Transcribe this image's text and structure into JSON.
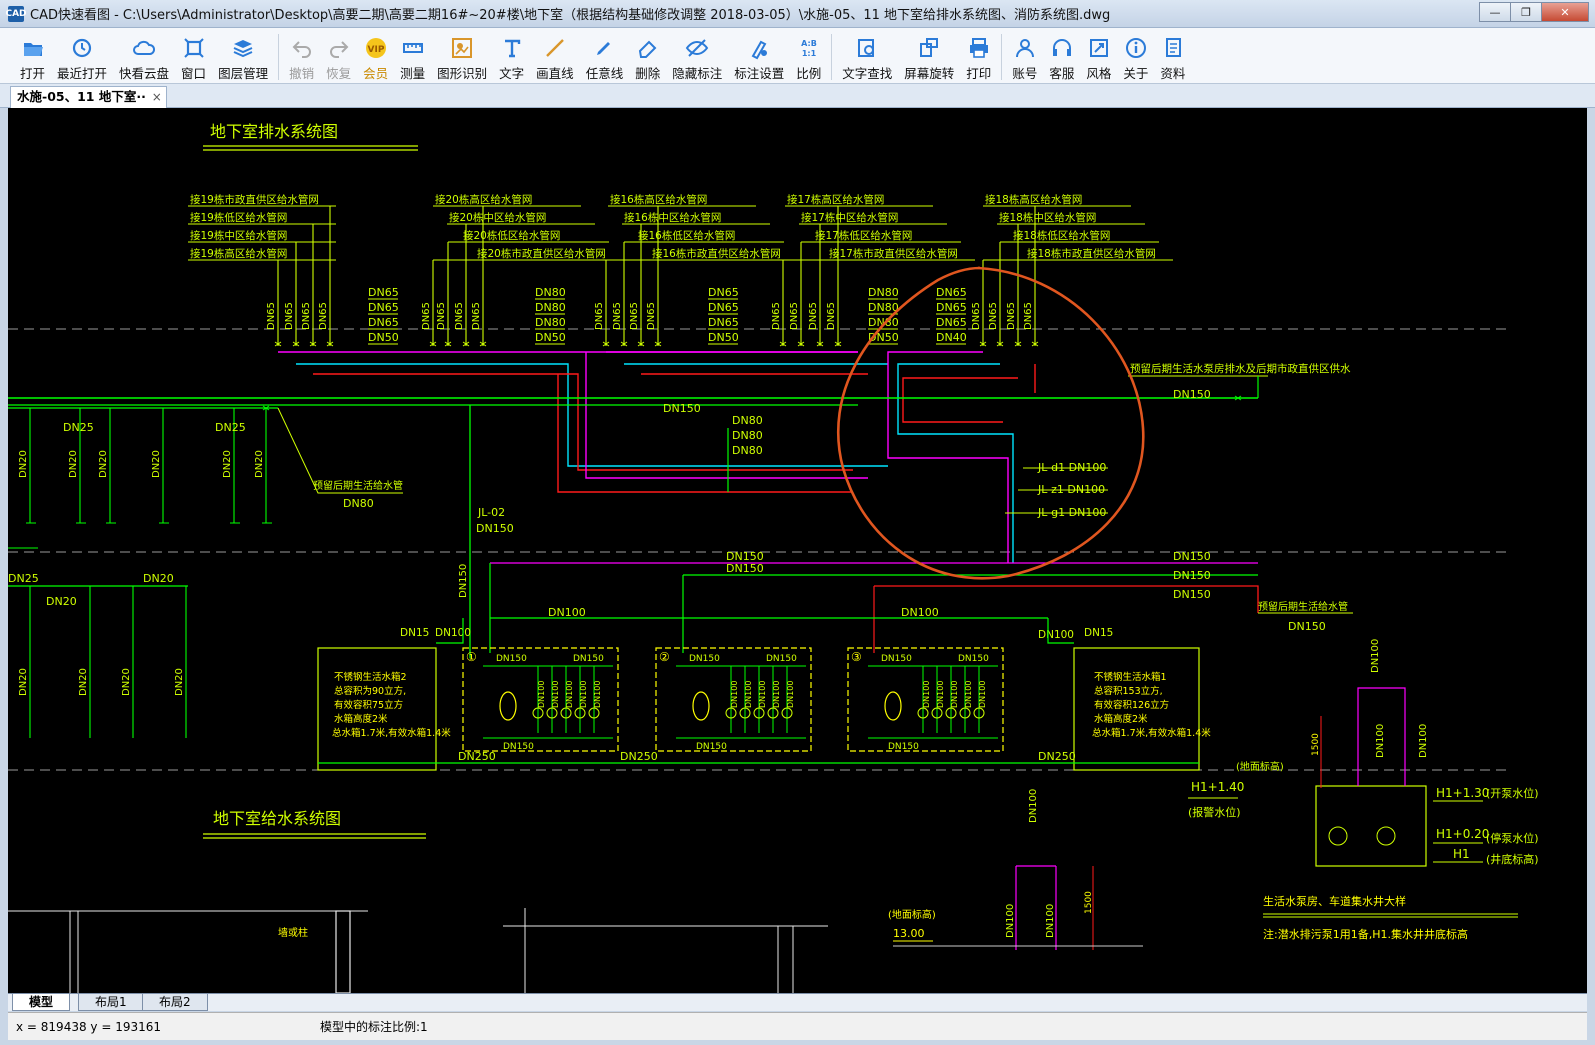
{
  "window": {
    "title": "CAD快速看图 - C:\\Users\\Administrator\\Desktop\\高要二期\\高要二期16#~20#楼\\地下室（根据结构基础修改调整 2018-03-05）\\水施-05、11 地下室给排水系统图、消防系统图.dwg",
    "app_icon": "CAD"
  },
  "toolbar": [
    {
      "label": "打开",
      "icon": "folder-open-icon",
      "state": "enabled"
    },
    {
      "label": "最近打开",
      "icon": "clock-icon",
      "state": "enabled"
    },
    {
      "label": "快看云盘",
      "icon": "cloud-icon",
      "state": "enabled"
    },
    {
      "label": "窗口",
      "icon": "window-icon",
      "state": "enabled"
    },
    {
      "label": "图层管理",
      "icon": "layers-icon",
      "state": "enabled"
    },
    {
      "label": "撤销",
      "icon": "undo-icon",
      "state": "disabled"
    },
    {
      "label": "恢复",
      "icon": "redo-icon",
      "state": "disabled"
    },
    {
      "label": "会员",
      "icon": "vip-icon",
      "state": "vip"
    },
    {
      "label": "测量",
      "icon": "ruler-icon",
      "state": "enabled"
    },
    {
      "label": "图形识别",
      "icon": "shape-recognize-icon",
      "state": "enabled"
    },
    {
      "label": "文字",
      "icon": "text-icon",
      "state": "enabled"
    },
    {
      "label": "画直线",
      "icon": "line-icon",
      "state": "enabled"
    },
    {
      "label": "任意线",
      "icon": "pen-icon",
      "state": "enabled"
    },
    {
      "label": "删除",
      "icon": "eraser-icon",
      "state": "enabled"
    },
    {
      "label": "隐藏标注",
      "icon": "eye-hidden-icon",
      "state": "enabled"
    },
    {
      "label": "标注设置",
      "icon": "annotation-settings-icon",
      "state": "enabled"
    },
    {
      "label": "比例",
      "icon": "scale-icon",
      "state": "enabled"
    },
    {
      "label": "文字查找",
      "icon": "text-search-icon",
      "state": "enabled"
    },
    {
      "label": "屏幕旋转",
      "icon": "rotate-icon",
      "state": "enabled"
    },
    {
      "label": "打印",
      "icon": "printer-icon",
      "state": "enabled"
    },
    {
      "label": "账号",
      "icon": "user-icon",
      "state": "enabled"
    },
    {
      "label": "客服",
      "icon": "headset-icon",
      "state": "enabled"
    },
    {
      "label": "风格",
      "icon": "style-icon",
      "state": "enabled"
    },
    {
      "label": "关于",
      "icon": "info-icon",
      "state": "enabled"
    },
    {
      "label": "资料",
      "icon": "documents-icon",
      "state": "enabled"
    }
  ],
  "document_tab": {
    "label": "水施-05、11 地下室··",
    "close": "×"
  },
  "drawing": {
    "title_drainage": "地下室排水系统图",
    "title_supply": "地下室给水系统图",
    "supply_labels": [
      "接19栋市政直供区给水管网",
      "接19栋低区给水管网",
      "接19栋中区给水管网",
      "接19栋高区给水管网",
      "接20栋高区给水管网",
      "接20栋中区给水管网",
      "接20栋低区给水管网",
      "接20栋市政直供区给水管网",
      "接16栋高区给水管网",
      "接16栋中区给水管网",
      "接16栋低区给水管网",
      "接16栋市政直供区给水管网",
      "接17栋高区给水管网",
      "接17栋中区给水管网",
      "接17栋低区给水管网",
      "接17栋市政直供区给水管网",
      "接18栋高区给水管网",
      "接18栋中区给水管网",
      "接18栋低区给水管网",
      "接18栋市政直供区给水管网"
    ],
    "pipe_labels": {
      "dn150": "DN150",
      "dn100": "DN100",
      "dn80": "DN80",
      "dn65": "DN65",
      "dn50": "DN50",
      "dn40": "DN40",
      "dn25": "DN25",
      "dn20": "DN20",
      "dn15": "DN15",
      "dn250": "DN250"
    },
    "risers": [
      "JL-d1 DN100",
      "JL-z1 DN100",
      "JL-g1 DN100",
      "JL-02"
    ],
    "notes": {
      "reserve_top": "预留后期生活水泵房排水及后期市政直供区供水",
      "reserve_left": "预留后期生活给水管",
      "reserve_right": "预留后期生活给水管",
      "tank_left": [
        "不锈钢生活水箱2",
        "总容积为90立方,",
        "有效容积75立方",
        "水箱高度2米",
        "总水箱1.7米,有效水箱1.4米"
      ],
      "tank_right": [
        "不锈钢生活水箱1",
        "总容积153立方,",
        "有效容积126立方",
        "水箱高度2米",
        "总水箱1.7米,有效水箱1.4米"
      ],
      "ground_level": "(地面标高)",
      "h1_140": "H1+1.40",
      "alarm_level": "(报警水位)",
      "h1_130": "H1+1.30",
      "start_pump": "(开泵水位)",
      "h1_020": "H1+0.20",
      "stop_pump": "(停泵水位)",
      "h1": "H1",
      "well_bottom": "(井底标高)",
      "pump_room_title": "生活水泵房、车道集水井大样",
      "pump_room_note": "注:潜水排污泵1用1备,H1.集水井井底标高",
      "floor_level": "(地面标高)",
      "elev_1300": "13.00",
      "wall_label": "墙或柱",
      "dim_1500": "1500"
    }
  },
  "layout_tabs": [
    "模型",
    "布局1",
    "布局2"
  ],
  "status": {
    "coords": "x = 819438  y = 193161",
    "scale": "模型中的标注比例:1"
  },
  "colors": {
    "canvas_bg": "#000000",
    "green": "#00ff00",
    "yellow_green": "#cfff00",
    "yellow": "#ffff00",
    "magenta": "#ff00ff",
    "cyan": "#00e5ff",
    "red": "#ff1a1a",
    "annotation_orange": "#e0561f"
  }
}
